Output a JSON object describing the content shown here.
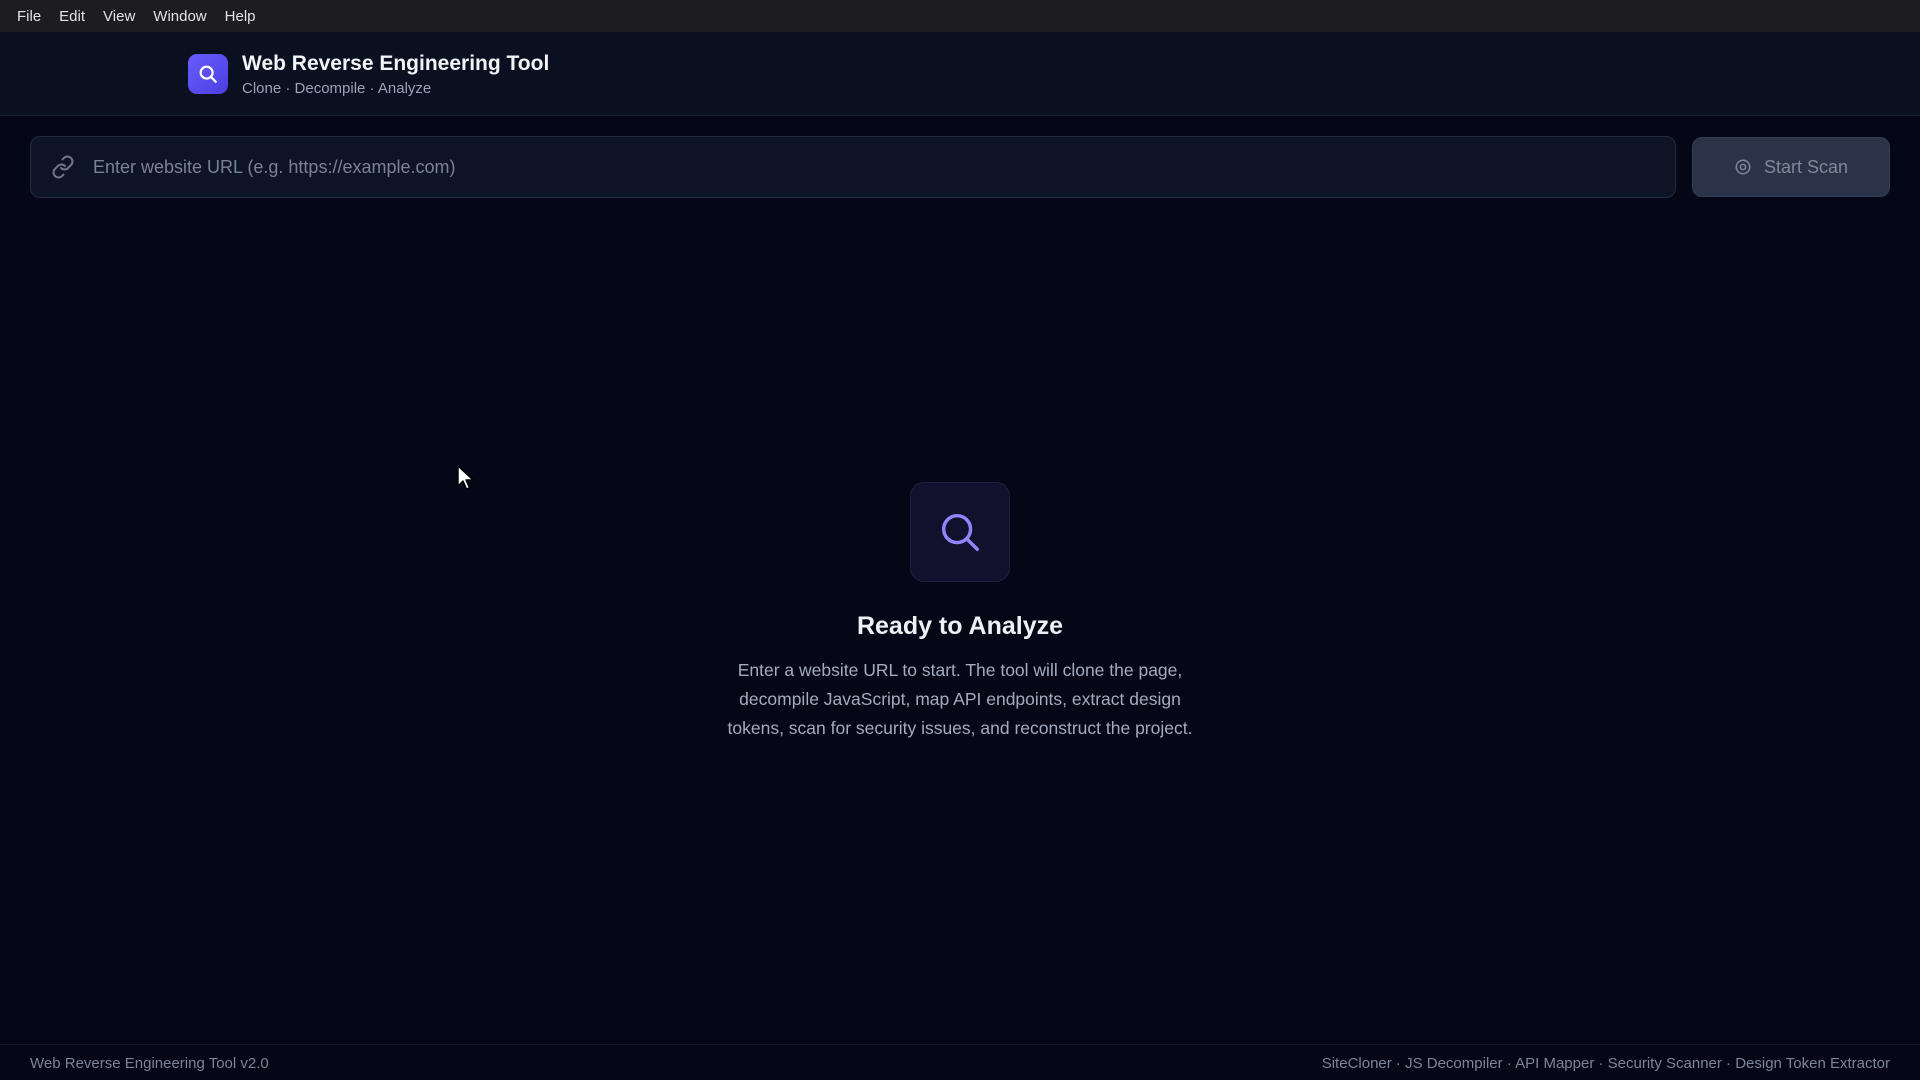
{
  "menubar": {
    "items": [
      "File",
      "Edit",
      "View",
      "Window",
      "Help"
    ]
  },
  "header": {
    "title": "Web Reverse Engineering Tool",
    "subtitle": "Clone · Decompile · Analyze",
    "logo_icon": "search-icon",
    "accent_color": "#5b4ff0"
  },
  "url_bar": {
    "placeholder": "Enter website URL (e.g. https://example.com)",
    "value": "",
    "icon": "link-icon"
  },
  "scan_button": {
    "label": "Start Scan",
    "icon": "target-icon",
    "state": "disabled"
  },
  "empty_state": {
    "icon": "search-icon",
    "title": "Ready to Analyze",
    "description": "Enter a website URL to start. The tool will clone the page, decompile JavaScript, map API endpoints, extract design tokens, scan for security issues, and reconstruct the project."
  },
  "footer": {
    "version": "Web Reverse Engineering Tool v2.0",
    "modules": "SiteCloner · JS Decompiler · API Mapper · Security Scanner · Design Token Extractor"
  }
}
